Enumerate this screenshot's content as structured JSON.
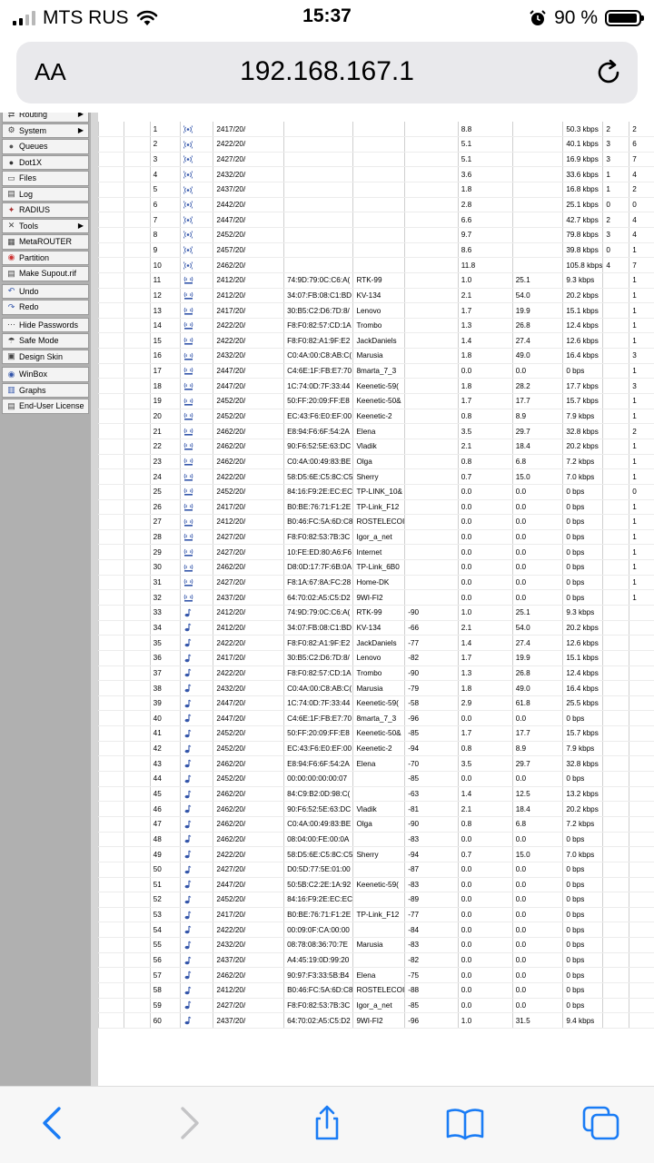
{
  "status_bar": {
    "carrier": "MTS RUS",
    "time": "15:37",
    "battery": "90 %"
  },
  "url_bar": {
    "aa_label": "AA",
    "url": "192.168.167.1"
  },
  "menu": [
    {
      "label": "Routing",
      "icon": "routing-icon",
      "arrow": true
    },
    {
      "label": "System",
      "icon": "gear-icon",
      "arrow": true
    },
    {
      "label": "Queues",
      "icon": "queues-icon",
      "arrow": false
    },
    {
      "label": "Dot1X",
      "icon": "dot1x-icon",
      "arrow": false
    },
    {
      "label": "Files",
      "icon": "folder-icon",
      "arrow": false
    },
    {
      "label": "Log",
      "icon": "log-icon",
      "arrow": false
    },
    {
      "label": "RADIUS",
      "icon": "radius-icon",
      "arrow": false
    },
    {
      "label": "Tools",
      "icon": "tools-icon",
      "arrow": true
    },
    {
      "label": "MetaROUTER",
      "icon": "metarouter-icon",
      "arrow": false
    },
    {
      "label": "Partition",
      "icon": "partition-icon",
      "arrow": false
    },
    {
      "label": "Make Supout.rif",
      "icon": "supout-icon",
      "arrow": false
    },
    {
      "label": "Undo",
      "icon": "undo-icon",
      "arrow": false
    },
    {
      "label": "Redo",
      "icon": "redo-icon",
      "arrow": false
    },
    {
      "label": "Hide Passwords",
      "icon": "password-icon",
      "arrow": false
    },
    {
      "label": "Safe Mode",
      "icon": "safe-mode-icon",
      "arrow": false
    },
    {
      "label": "Design Skin",
      "icon": "design-skin-icon",
      "arrow": false
    },
    {
      "label": "WinBox",
      "icon": "winbox-icon",
      "arrow": false
    },
    {
      "label": "Graphs",
      "icon": "graphs-icon",
      "arrow": false
    },
    {
      "label": "End-User License",
      "icon": "license-icon",
      "arrow": false
    }
  ],
  "table": {
    "rows": [
      [
        "1",
        "ap",
        "2417/20/",
        "",
        "",
        "",
        "8.8",
        "",
        "50.3 kbps",
        "2",
        "2"
      ],
      [
        "2",
        "ap",
        "2422/20/",
        "",
        "",
        "",
        "5.1",
        "",
        "40.1 kbps",
        "3",
        "6"
      ],
      [
        "3",
        "ap",
        "2427/20/",
        "",
        "",
        "",
        "5.1",
        "",
        "16.9 kbps",
        "3",
        "7"
      ],
      [
        "4",
        "ap",
        "2432/20/",
        "",
        "",
        "",
        "3.6",
        "",
        "33.6 kbps",
        "1",
        "4"
      ],
      [
        "5",
        "ap",
        "2437/20/",
        "",
        "",
        "",
        "1.8",
        "",
        "16.8 kbps",
        "1",
        "2"
      ],
      [
        "6",
        "ap",
        "2442/20/",
        "",
        "",
        "",
        "2.8",
        "",
        "25.1 kbps",
        "0",
        "0"
      ],
      [
        "7",
        "ap",
        "2447/20/",
        "",
        "",
        "",
        "6.6",
        "",
        "42.7 kbps",
        "2",
        "4"
      ],
      [
        "8",
        "ap",
        "2452/20/",
        "",
        "",
        "",
        "9.7",
        "",
        "79.8 kbps",
        "3",
        "4"
      ],
      [
        "9",
        "ap",
        "2457/20/",
        "",
        "",
        "",
        "8.6",
        "",
        "39.8 kbps",
        "0",
        "1"
      ],
      [
        "10",
        "ap",
        "2462/20/",
        "",
        "",
        "",
        "11.8",
        "",
        "105.8 kbps",
        "4",
        "7"
      ],
      [
        "11",
        "net",
        "2412/20/",
        "74:9D:79:0C:C6:A(",
        "RTK-99",
        "",
        "1.0",
        "25.1",
        "9.3 kbps",
        "",
        "1"
      ],
      [
        "12",
        "net",
        "2412/20/",
        "34:07:FB:08:C1:BD",
        "KV-134",
        "",
        "2.1",
        "54.0",
        "20.2 kbps",
        "",
        "1"
      ],
      [
        "13",
        "net",
        "2417/20/",
        "30:B5:C2:D6:7D:8/",
        "Lenovo",
        "",
        "1.7",
        "19.9",
        "15.1 kbps",
        "",
        "1"
      ],
      [
        "14",
        "net",
        "2422/20/",
        "F8:F0:82:57:CD:1A",
        "Trombo",
        "",
        "1.3",
        "26.8",
        "12.4 kbps",
        "",
        "1"
      ],
      [
        "15",
        "net",
        "2422/20/",
        "F8:F0:82:A1:9F:E2",
        "JackDaniels",
        "",
        "1.4",
        "27.4",
        "12.6 kbps",
        "",
        "1"
      ],
      [
        "16",
        "net",
        "2432/20/",
        "C0:4A:00:C8:AB:C(",
        "Marusia",
        "",
        "1.8",
        "49.0",
        "16.4 kbps",
        "",
        "3"
      ],
      [
        "17",
        "net",
        "2447/20/",
        "C4:6E:1F:FB:E7:70",
        "8marta_7_3",
        "",
        "0.0",
        "0.0",
        "0 bps",
        "",
        "1"
      ],
      [
        "18",
        "net",
        "2447/20/",
        "1C:74:0D:7F:33:44",
        "Keenetic-59(",
        "",
        "1.8",
        "28.2",
        "17.7 kbps",
        "",
        "3"
      ],
      [
        "19",
        "net",
        "2452/20/",
        "50:FF:20:09:FF:E8",
        "Keenetic-50&",
        "",
        "1.7",
        "17.7",
        "15.7 kbps",
        "",
        "1"
      ],
      [
        "20",
        "net",
        "2452/20/",
        "EC:43:F6:E0:EF:00",
        "Keenetic-2",
        "",
        "0.8",
        "8.9",
        "7.9 kbps",
        "",
        "1"
      ],
      [
        "21",
        "net",
        "2462/20/",
        "E8:94:F6:6F:54:2A",
        "Elena",
        "",
        "3.5",
        "29.7",
        "32.8 kbps",
        "",
        "2"
      ],
      [
        "22",
        "net",
        "2462/20/",
        "90:F6:52:5E:63:DC",
        "Vladik",
        "",
        "2.1",
        "18.4",
        "20.2 kbps",
        "",
        "1"
      ],
      [
        "23",
        "net",
        "2462/20/",
        "C0:4A:00:49:83:BE",
        "Olga",
        "",
        "0.8",
        "6.8",
        "7.2 kbps",
        "",
        "1"
      ],
      [
        "24",
        "net",
        "2422/20/",
        "58:D5:6E:C5:8C:C5",
        "Sherry",
        "",
        "0.7",
        "15.0",
        "7.0 kbps",
        "",
        "1"
      ],
      [
        "25",
        "net",
        "2452/20/",
        "84:16:F9:2E:EC:EC",
        "TP-LINK_10&",
        "",
        "0.0",
        "0.0",
        "0 bps",
        "",
        "0"
      ],
      [
        "26",
        "net",
        "2417/20/",
        "B0:BE:76:71:F1:2E",
        "TP-Link_F12",
        "",
        "0.0",
        "0.0",
        "0 bps",
        "",
        "1"
      ],
      [
        "27",
        "net",
        "2412/20/",
        "B0:46:FC:5A:6D:C8",
        "ROSTELECOI",
        "",
        "0.0",
        "0.0",
        "0 bps",
        "",
        "1"
      ],
      [
        "28",
        "net",
        "2427/20/",
        "F8:F0:82:53:7B:3C",
        "Igor_a_net",
        "",
        "0.0",
        "0.0",
        "0 bps",
        "",
        "1"
      ],
      [
        "29",
        "net",
        "2427/20/",
        "10:FE:ED:80:A6:F6",
        "Internet",
        "",
        "0.0",
        "0.0",
        "0 bps",
        "",
        "1"
      ],
      [
        "30",
        "net",
        "2462/20/",
        "D8:0D:17:7F:6B:0A",
        "TP-Link_6B0",
        "",
        "0.0",
        "0.0",
        "0 bps",
        "",
        "1"
      ],
      [
        "31",
        "net",
        "2427/20/",
        "F8:1A:67:8A:FC:28",
        "Home-DK",
        "",
        "0.0",
        "0.0",
        "0 bps",
        "",
        "1"
      ],
      [
        "32",
        "net",
        "2437/20/",
        "64:70:02:A5:C5:D2",
        "9WI-FI2",
        "",
        "0.0",
        "0.0",
        "0 bps",
        "",
        "1"
      ],
      [
        "33",
        "cl",
        "2412/20/",
        "74:9D:79:0C:C6:A(",
        "RTK-99",
        "-90",
        "1.0",
        "25.1",
        "9.3 kbps",
        "",
        ""
      ],
      [
        "34",
        "cl",
        "2412/20/",
        "34:07:FB:08:C1:BD",
        "KV-134",
        "-66",
        "2.1",
        "54.0",
        "20.2 kbps",
        "",
        ""
      ],
      [
        "35",
        "cl",
        "2422/20/",
        "F8:F0:82:A1:9F:E2",
        "JackDaniels",
        "-77",
        "1.4",
        "27.4",
        "12.6 kbps",
        "",
        ""
      ],
      [
        "36",
        "cl",
        "2417/20/",
        "30:B5:C2:D6:7D:8/",
        "Lenovo",
        "-82",
        "1.7",
        "19.9",
        "15.1 kbps",
        "",
        ""
      ],
      [
        "37",
        "cl",
        "2422/20/",
        "F8:F0:82:57:CD:1A",
        "Trombo",
        "-90",
        "1.3",
        "26.8",
        "12.4 kbps",
        "",
        ""
      ],
      [
        "38",
        "cl",
        "2432/20/",
        "C0:4A:00:C8:AB:C(",
        "Marusia",
        "-79",
        "1.8",
        "49.0",
        "16.4 kbps",
        "",
        ""
      ],
      [
        "39",
        "cl",
        "2447/20/",
        "1C:74:0D:7F:33:44",
        "Keenetic-59(",
        "-58",
        "2.9",
        "61.8",
        "25.5 kbps",
        "",
        ""
      ],
      [
        "40",
        "cl",
        "2447/20/",
        "C4:6E:1F:FB:E7:70",
        "8marta_7_3",
        "-96",
        "0.0",
        "0.0",
        "0 bps",
        "",
        ""
      ],
      [
        "41",
        "cl",
        "2452/20/",
        "50:FF:20:09:FF:E8",
        "Keenetic-50&",
        "-85",
        "1.7",
        "17.7",
        "15.7 kbps",
        "",
        ""
      ],
      [
        "42",
        "cl",
        "2452/20/",
        "EC:43:F6:E0:EF:00",
        "Keenetic-2",
        "-94",
        "0.8",
        "8.9",
        "7.9 kbps",
        "",
        ""
      ],
      [
        "43",
        "cl",
        "2462/20/",
        "E8:94:F6:6F:54:2A",
        "Elena",
        "-70",
        "3.5",
        "29.7",
        "32.8 kbps",
        "",
        ""
      ],
      [
        "44",
        "cl",
        "2452/20/",
        "00:00:00:00:00:07",
        "",
        "-85",
        "0.0",
        "0.0",
        "0 bps",
        "",
        ""
      ],
      [
        "45",
        "cl",
        "2462/20/",
        "84:C9:B2:0D:98:C(",
        "",
        "-63",
        "1.4",
        "12.5",
        "13.2 kbps",
        "",
        ""
      ],
      [
        "46",
        "cl",
        "2462/20/",
        "90:F6:52:5E:63:DC",
        "Vladik",
        "-81",
        "2.1",
        "18.4",
        "20.2 kbps",
        "",
        ""
      ],
      [
        "47",
        "cl",
        "2462/20/",
        "C0:4A:00:49:83:BE",
        "Olga",
        "-90",
        "0.8",
        "6.8",
        "7.2 kbps",
        "",
        ""
      ],
      [
        "48",
        "cl",
        "2462/20/",
        "08:04:00:FE:00:0A",
        "",
        "-83",
        "0.0",
        "0.0",
        "0 bps",
        "",
        ""
      ],
      [
        "49",
        "cl",
        "2422/20/",
        "58:D5:6E:C5:8C:C5",
        "Sherry",
        "-94",
        "0.7",
        "15.0",
        "7.0 kbps",
        "",
        ""
      ],
      [
        "50",
        "cl",
        "2427/20/",
        "D0:5D:77:5E:01:00",
        "",
        "-87",
        "0.0",
        "0.0",
        "0 bps",
        "",
        ""
      ],
      [
        "51",
        "cl",
        "2447/20/",
        "50:5B:C2:2E:1A:92",
        "Keenetic-59(",
        "-83",
        "0.0",
        "0.0",
        "0 bps",
        "",
        ""
      ],
      [
        "52",
        "cl",
        "2452/20/",
        "84:16:F9:2E:EC:EC",
        "",
        "-89",
        "0.0",
        "0.0",
        "0 bps",
        "",
        ""
      ],
      [
        "53",
        "cl",
        "2417/20/",
        "B0:BE:76:71:F1:2E",
        "TP-Link_F12",
        "-77",
        "0.0",
        "0.0",
        "0 bps",
        "",
        ""
      ],
      [
        "54",
        "cl",
        "2422/20/",
        "00:09:0F:CA:00:00",
        "",
        "-84",
        "0.0",
        "0.0",
        "0 bps",
        "",
        ""
      ],
      [
        "55",
        "cl",
        "2432/20/",
        "08:78:08:36:70:7E",
        "Marusia",
        "-83",
        "0.0",
        "0.0",
        "0 bps",
        "",
        ""
      ],
      [
        "56",
        "cl",
        "2437/20/",
        "A4:45:19:0D:99:20",
        "",
        "-82",
        "0.0",
        "0.0",
        "0 bps",
        "",
        ""
      ],
      [
        "57",
        "cl",
        "2462/20/",
        "90:97:F3:33:5B:B4",
        "Elena",
        "-75",
        "0.0",
        "0.0",
        "0 bps",
        "",
        ""
      ],
      [
        "58",
        "cl",
        "2412/20/",
        "B0:46:FC:5A:6D:C8",
        "ROSTELECOI",
        "-88",
        "0.0",
        "0.0",
        "0 bps",
        "",
        ""
      ],
      [
        "59",
        "cl",
        "2427/20/",
        "F8:F0:82:53:7B:3C",
        "Igor_a_net",
        "-85",
        "0.0",
        "0.0",
        "0 bps",
        "",
        ""
      ],
      [
        "60",
        "cl",
        "2437/20/",
        "64:70:02:A5:C5:D2",
        "9WI-FI2",
        "-96",
        "1.0",
        "31.5",
        "9.4 kbps",
        "",
        ""
      ]
    ]
  },
  "colors": {
    "sidebar_bg": "#b0b0b0",
    "ios_blue": "#1a7cf5",
    "icon_blue": "#3355aa"
  }
}
